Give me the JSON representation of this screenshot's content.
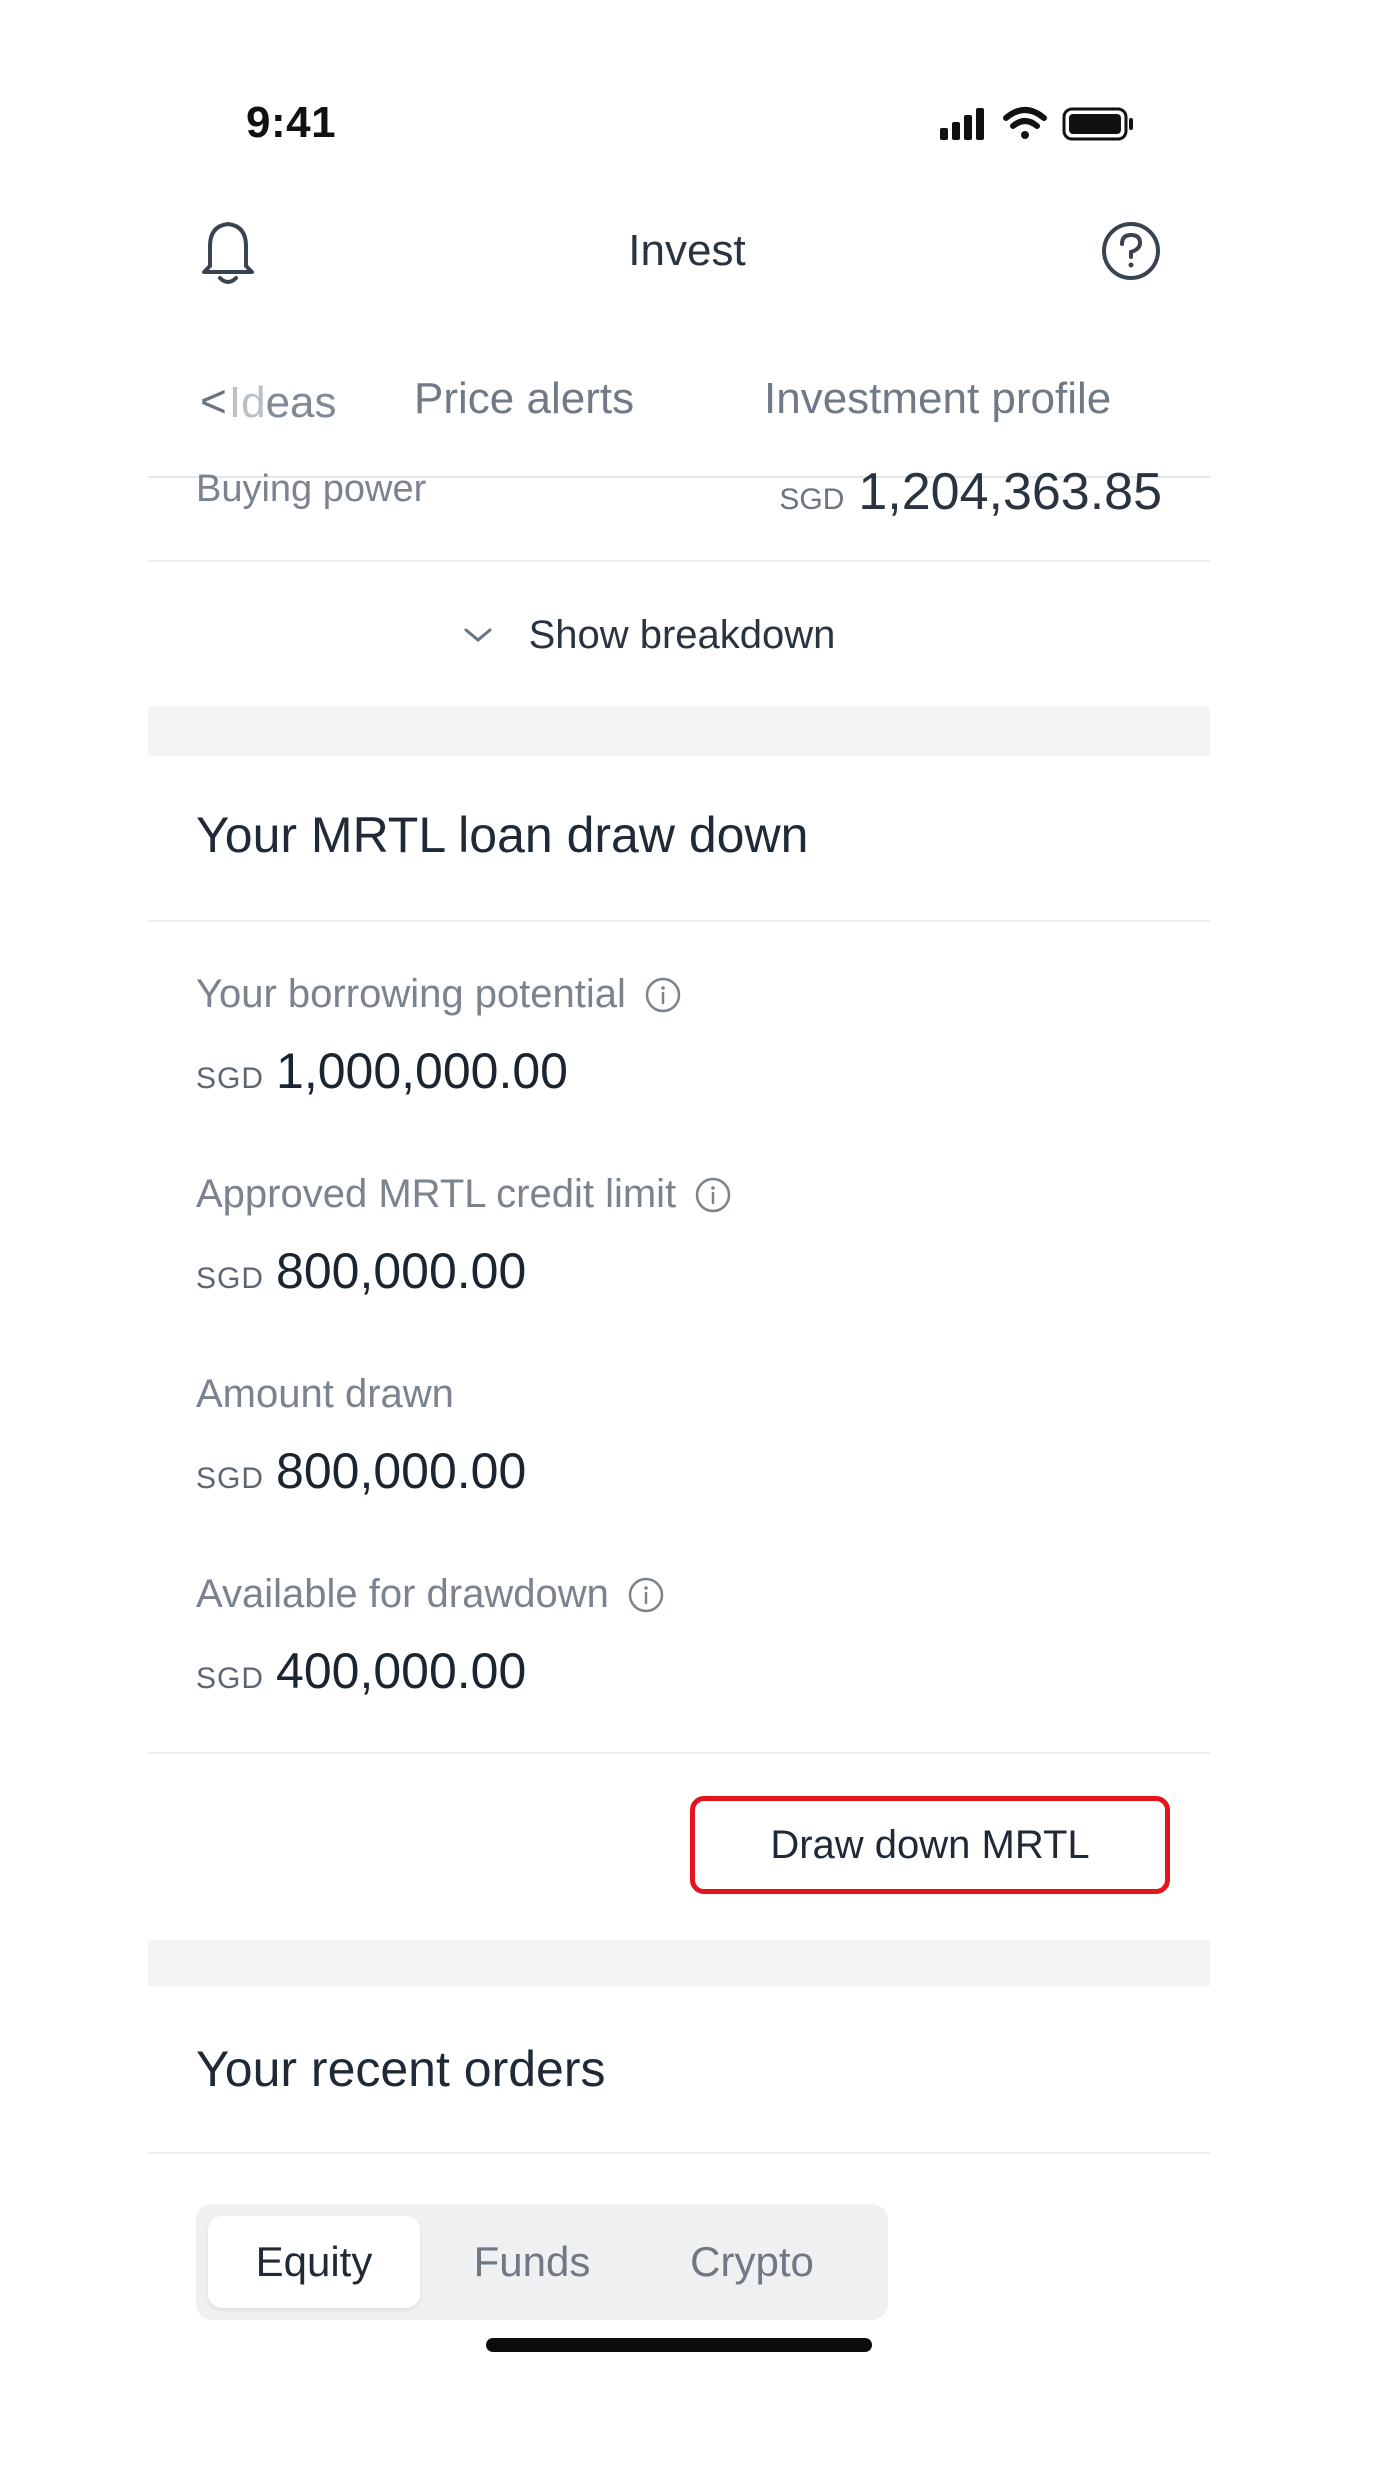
{
  "status_bar": {
    "time": "9:41"
  },
  "header": {
    "title": "Invest"
  },
  "tabs": [
    {
      "label_prefix": "<",
      "label_faded": "Id",
      "label": "eas"
    },
    {
      "label": "Price alerts"
    },
    {
      "label": "Investment profile"
    }
  ],
  "buying_power": {
    "label": "Buying power",
    "currency": "SGD",
    "value": "1,204,363.85"
  },
  "breakdown": {
    "label": "Show breakdown"
  },
  "mrtl": {
    "title": "Your MRTL loan draw down",
    "metrics": [
      {
        "label": "Your borrowing potential",
        "currency": "SGD",
        "value": "1,000,000.00",
        "has_info": true
      },
      {
        "label": "Approved MRTL credit limit",
        "currency": "SGD",
        "value": "800,000.00",
        "has_info": true
      },
      {
        "label": "Amount drawn",
        "currency": "SGD",
        "value": "800,000.00",
        "has_info": false
      },
      {
        "label": "Available for drawdown",
        "currency": "SGD",
        "value": "400,000.00",
        "has_info": true
      }
    ],
    "draw_button": "Draw down MRTL"
  },
  "recent_orders": {
    "title": "Your recent orders",
    "segments": [
      "Equity",
      "Funds",
      "Crypto"
    ],
    "selected": "Equity"
  },
  "colors": {
    "highlight": "#e5141c",
    "text": "#1f2a36",
    "muted": "#7a838e"
  },
  "icons": [
    "bell-icon",
    "help-icon",
    "chevron-left-icon",
    "chevron-down-icon",
    "info-icon",
    "signal-icon",
    "wifi-icon",
    "battery-icon"
  ]
}
